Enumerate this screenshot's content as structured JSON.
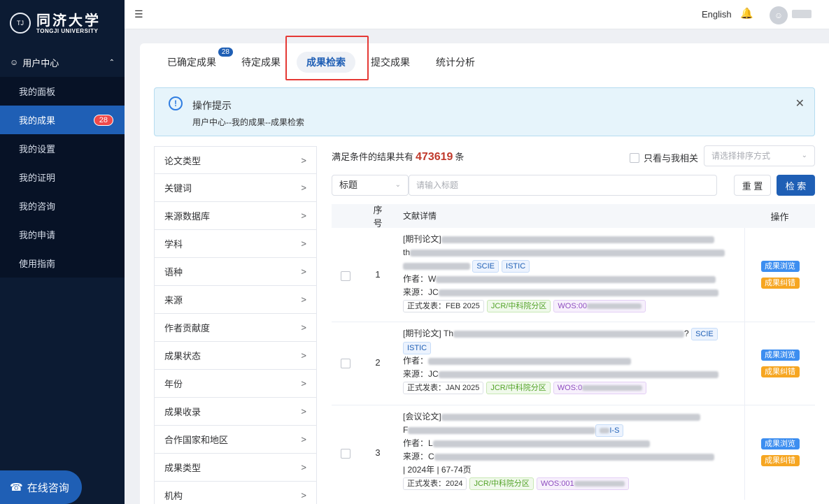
{
  "brand": {
    "seal_text": "TJ",
    "name_cn": "同济大学",
    "name_en": "TONGJI UNIVERSITY"
  },
  "sidebar": {
    "group_label": "用户中心",
    "items": [
      {
        "label": "我的面板"
      },
      {
        "label": "我的成果",
        "badge": "28"
      },
      {
        "label": "我的设置"
      },
      {
        "label": "我的证明"
      },
      {
        "label": "我的咨询"
      },
      {
        "label": "我的申请"
      },
      {
        "label": "使用指南"
      }
    ],
    "consult_label": "在线咨询"
  },
  "topbar": {
    "language": "English"
  },
  "tabs": [
    {
      "label": "已确定成果",
      "badge": "28"
    },
    {
      "label": "待定成果"
    },
    {
      "label": "成果检索",
      "active": true
    },
    {
      "label": "提交成果"
    },
    {
      "label": "统计分析"
    }
  ],
  "tip": {
    "title": "操作提示",
    "desc": "用户中心--我的成果--成果检索"
  },
  "filters": [
    "论文类型",
    "关键词",
    "来源数据库",
    "学科",
    "语种",
    "来源",
    "作者贡献度",
    "成果状态",
    "年份",
    "成果收录",
    "合作国家和地区",
    "成果类型",
    "机构"
  ],
  "results": {
    "summary_prefix": "满足条件的结果共有",
    "count": "473619",
    "summary_suffix": "条",
    "only_mine": "只看与我相关",
    "sort_placeholder": "请选择排序方式",
    "field": "标题",
    "search_placeholder": "请输入标题",
    "reset": "重 置",
    "search": "检 索"
  },
  "table": {
    "headers": {
      "no": "序号",
      "detail": "文献详情",
      "ops": "操作"
    },
    "view_label": "成果浏览",
    "fix_label": "成果纠错",
    "rows": [
      {
        "no": "1",
        "type": "[期刊论文]",
        "title_start": "",
        "line2_start": "th",
        "tags": [
          "SCIE",
          "ISTIC"
        ],
        "author_label": "作者：",
        "author_start": "W",
        "source_label": "来源：",
        "source_start": "JC",
        "publish": "正式发表：FEB 2025",
        "jcr": "JCR/中科院分区",
        "wos": "WOS:00"
      },
      {
        "no": "2",
        "type": "[期刊论文]",
        "title_start": "Th",
        "title_end": "?",
        "tags": [
          "SCIE",
          "ISTIC"
        ],
        "author_label": "作者：",
        "author_start": "",
        "source_label": "来源：",
        "source_start": "JC",
        "publish": "正式发表：JAN 2025",
        "jcr": "JCR/中科院分区",
        "wos": "WOS:0"
      },
      {
        "no": "3",
        "type": "[会议论文]",
        "title_start": "",
        "line2_start": "F",
        "tag_tail": "I-S",
        "author_label": "作者：",
        "author_start": "L",
        "source_label": "来源：",
        "source_start": "C",
        "extra": "| 2024年 | 67-74页",
        "publish": "正式发表：2024",
        "jcr": "JCR/中科院分区",
        "wos": "WOS:001"
      }
    ]
  }
}
